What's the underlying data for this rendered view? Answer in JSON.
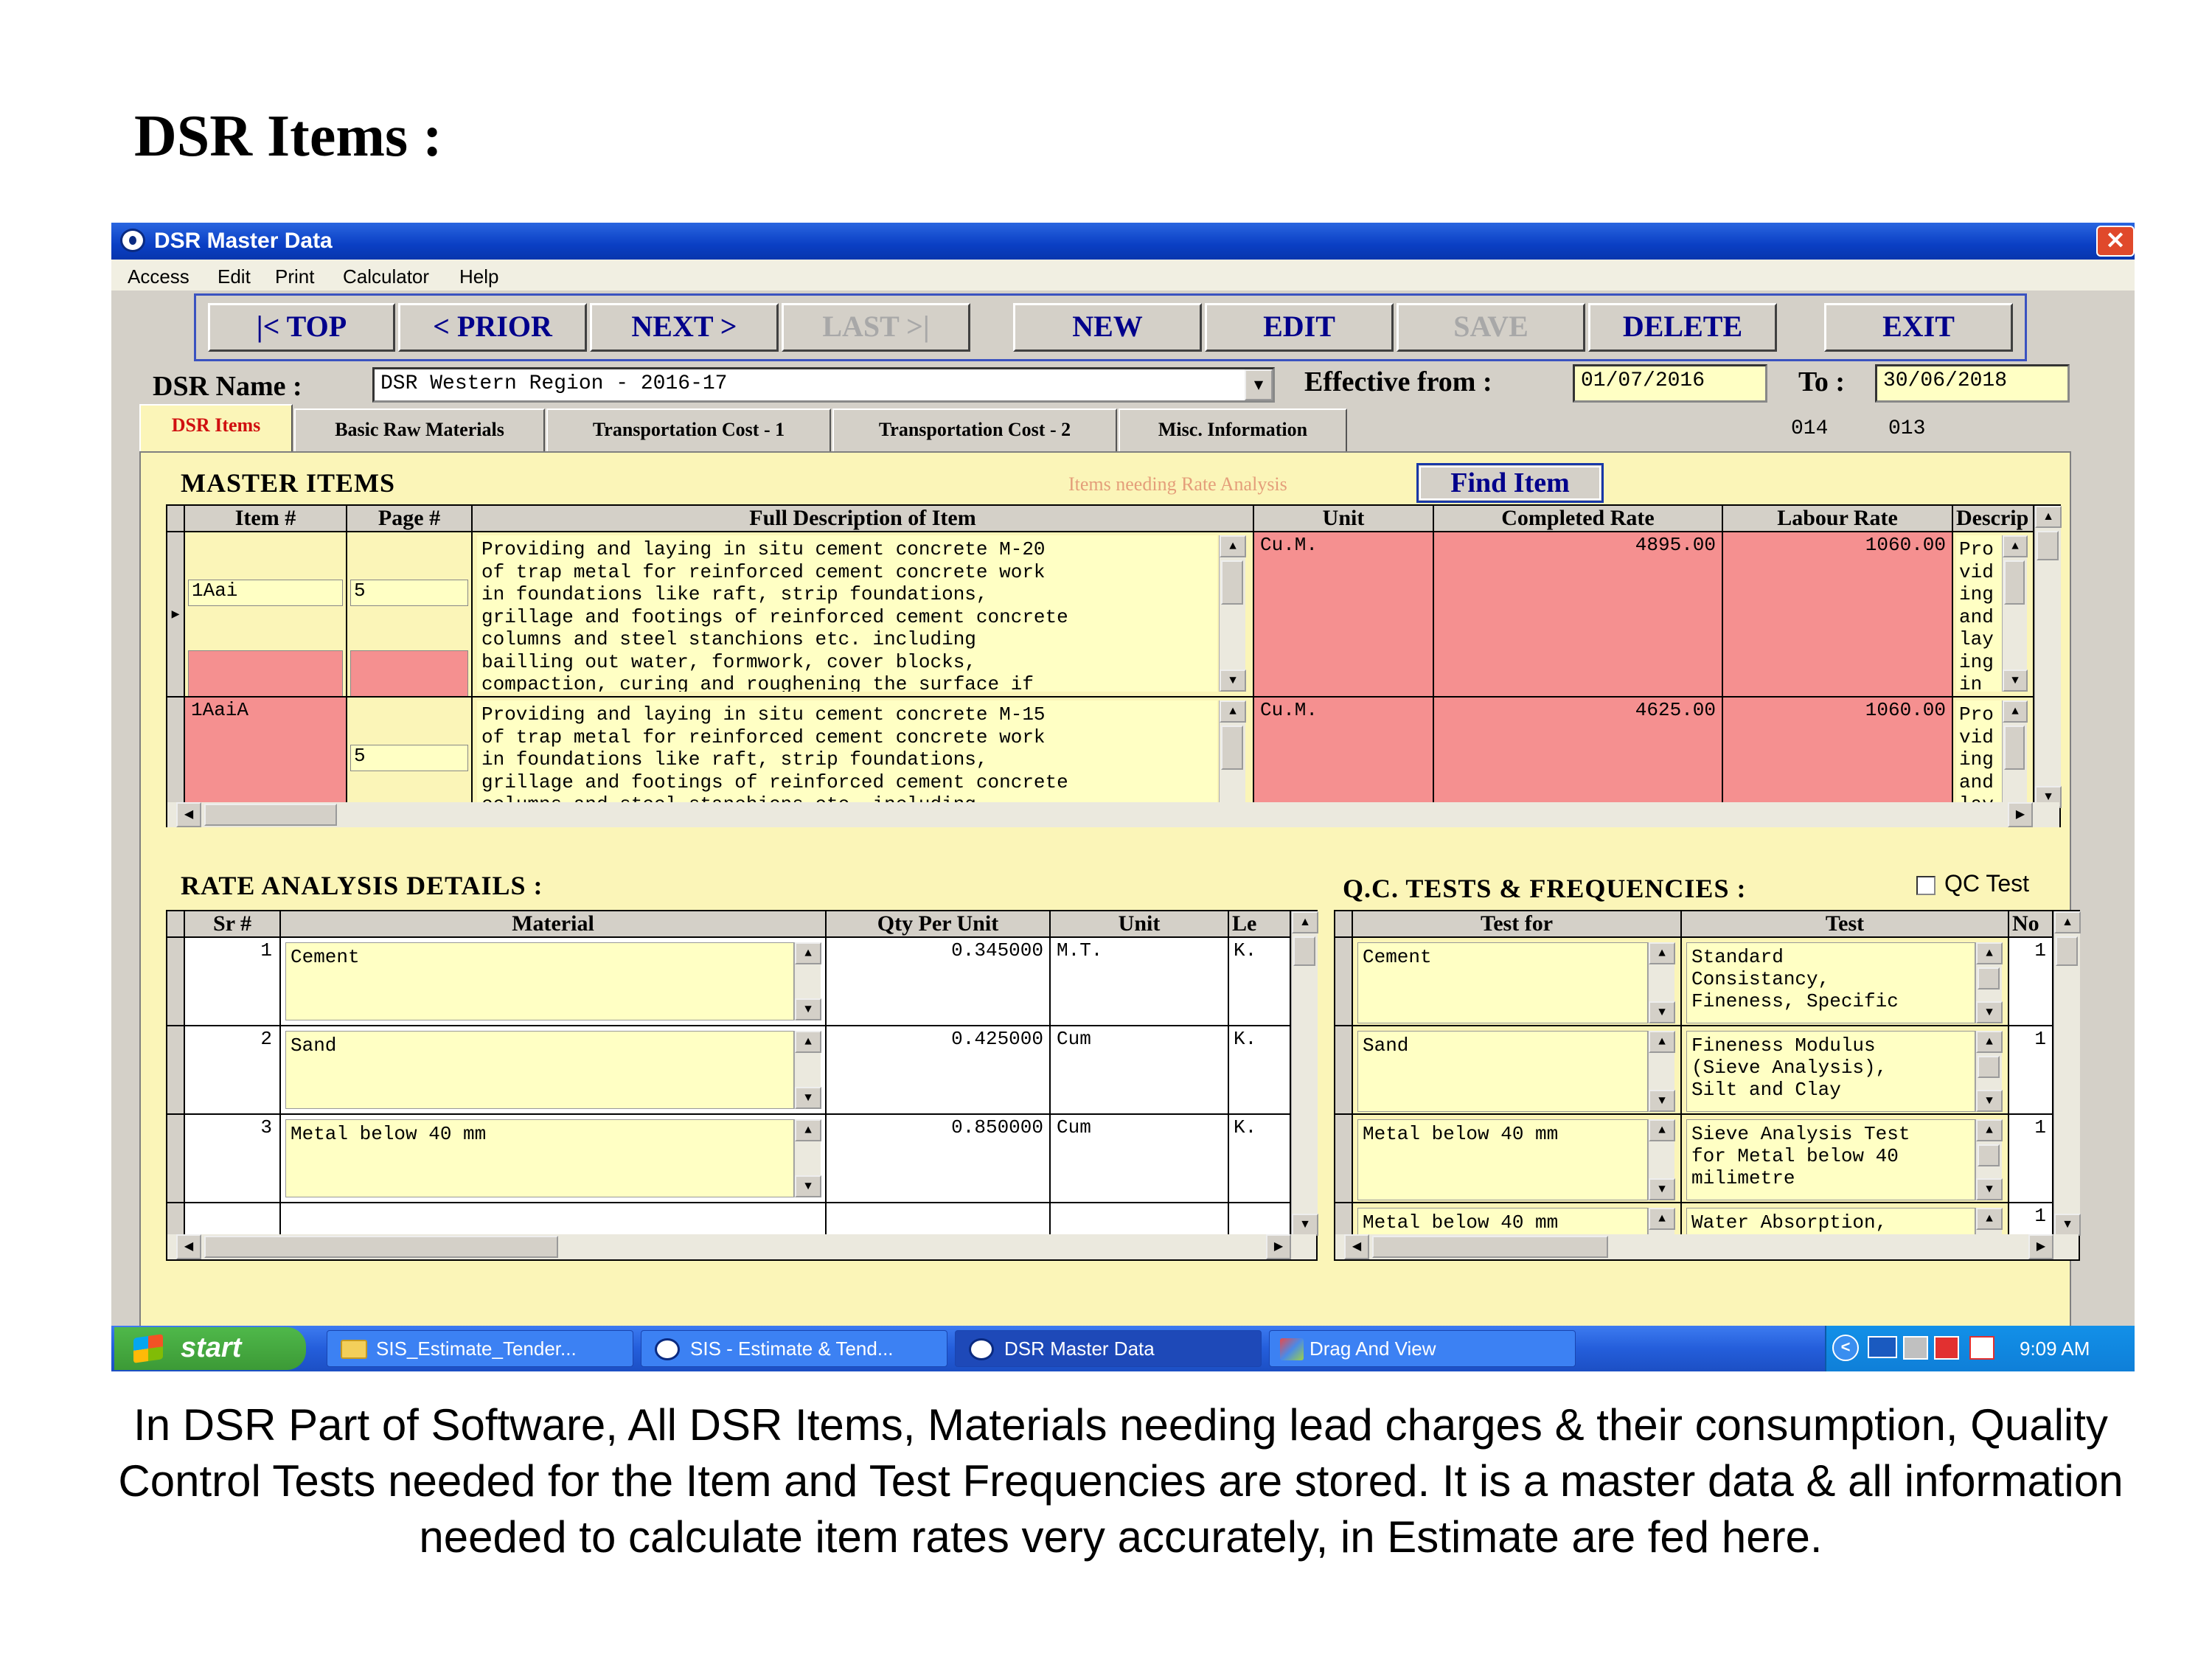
{
  "slide_title": "DSR Items :",
  "caption": "In DSR Part of Software, All DSR Items, Materials needing lead charges & their consumption, Quality Control Tests needed for the Item and Test Frequencies are stored. It is a master data & all information needed to calculate item rates very accurately, in Estimate are fed here.",
  "window": {
    "title": "DSR Master Data",
    "close_glyph": "✕"
  },
  "menu": [
    "Access",
    "Edit",
    "Print",
    "Calculator",
    "Help"
  ],
  "nav_buttons": {
    "top": "|< TOP",
    "prior": "< PRIOR",
    "next": "NEXT >",
    "last": "LAST >|",
    "new": "NEW",
    "edit": "EDIT",
    "save": "SAVE",
    "delete": "DELETE",
    "exit": "EXIT"
  },
  "dsr": {
    "name_label": "DSR Name :",
    "name_value": "DSR Western Region - 2016-17",
    "effective_label": "Effective from :",
    "effective_value": "01/07/2016",
    "to_label": "To :",
    "to_value": "30/06/2018",
    "code1": "014",
    "code2": "013"
  },
  "tabs": [
    "DSR Items",
    "Basic Raw Materials",
    "Transportation Cost - 1",
    "Transportation Cost - 2",
    "Misc. Information"
  ],
  "master": {
    "title": "MASTER ITEMS",
    "legend": "Items needing Rate Analysis",
    "find_button": "Find Item",
    "headers": [
      "Item #",
      "Page #",
      "Full Description of Item",
      "Unit",
      "Completed Rate",
      "Labour Rate",
      "Descrip"
    ],
    "rows": [
      {
        "item": "1Aai",
        "page": "5",
        "desc": "Providing and laying in situ cement concrete M-20\nof trap metal for reinforced cement concrete work\nin foundations like raft, strip foundations,\ngrillage and footings of reinforced cement concrete\ncolumns and steel stanchions etc. including\nbailling out water, formwork, cover blocks,\ncompaction, curing and roughening the surface if",
        "unit": "Cu.M.",
        "completed_rate": "4895.00",
        "labour_rate": "1060.00",
        "short": "Pro\nvid\ning\nand\nlay\ning\nin"
      },
      {
        "item": "1AaiA",
        "page": "5",
        "desc": "Providing and laying in situ cement concrete M-15\nof trap metal for reinforced cement concrete work\nin foundations like raft, strip foundations,\ngrillage and footings of reinforced cement concrete\ncolumns and steel stanchions etc. including",
        "unit": "Cu.M.",
        "completed_rate": "4625.00",
        "labour_rate": "1060.00",
        "short": "Pro\nvid\ning\nand\nlay"
      }
    ]
  },
  "rate_analysis": {
    "title": "RATE ANALYSIS DETAILS :",
    "headers": [
      "Sr #",
      "Material",
      "Qty Per Unit",
      "Unit",
      "Le"
    ],
    "rows": [
      {
        "sr": "1",
        "material": "Cement",
        "qty": "0.345000",
        "unit": "M.T.",
        "lead": "K."
      },
      {
        "sr": "2",
        "material": "Sand",
        "qty": "0.425000",
        "unit": "Cum",
        "lead": "K."
      },
      {
        "sr": "3",
        "material": "Metal below 40 mm",
        "qty": "0.850000",
        "unit": "Cum",
        "lead": "K."
      }
    ]
  },
  "qc": {
    "title": "Q.C. TESTS & FREQUENCIES :",
    "checkbox_label": "QC Test",
    "headers": [
      "Test for",
      "Test",
      "No"
    ],
    "rows": [
      {
        "test_for": "Cement",
        "test": "Standard\nConsistancy,\nFineness, Specific",
        "no": "1"
      },
      {
        "test_for": "Sand",
        "test": "Fineness Modulus\n(Sieve Analysis),\nSilt and Clay",
        "no": "1"
      },
      {
        "test_for": "Metal below 40 mm",
        "test": "Sieve Analysis Test\nfor Metal below 40\nmilimetre",
        "no": "1"
      },
      {
        "test_for": "Metal below 40 mm",
        "test": "Water Absorption,\nSpecific Gravity",
        "no": "1"
      }
    ]
  },
  "taskbar": {
    "start": "start",
    "items": [
      "SIS_Estimate_Tender...",
      "SIS - Estimate & Tend...",
      "DSR Master Data",
      "Drag And View"
    ],
    "time": "9:09 AM"
  },
  "colors": {
    "titlebar": "#0a3fc4",
    "panel": "#fbf5b8",
    "rate_analysis_highlight": "#f59090",
    "memo_bg": "#ffffc4",
    "nav_text": "#00008b"
  }
}
